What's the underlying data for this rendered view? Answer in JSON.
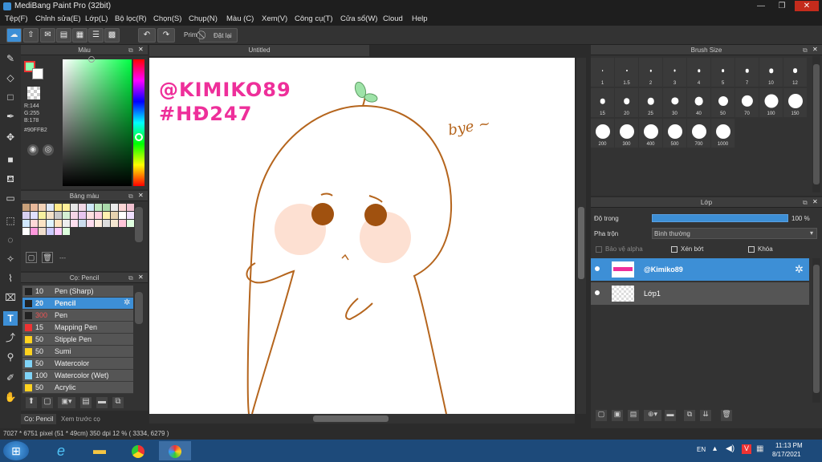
{
  "window": {
    "title": "MediBang Paint Pro (32bit)"
  },
  "menu": [
    "Tệp(F)",
    "Chỉnh sửa(E)",
    "Lớp(L)",
    "Bộ lọc(R)",
    "Chọn(S)",
    "Chụp(N)",
    "Màu (C)",
    "Xem(V)",
    "Công cụ(T)",
    "Cửa sổ(W)",
    "Cloud",
    "Help"
  ],
  "toolbar": {
    "prim_label": "Prim",
    "reset_label": "Đặt lại"
  },
  "color_panel": {
    "title": "Màu",
    "r": "R:144",
    "g": "G:255",
    "b": "B:178",
    "hex": "#90FFB2"
  },
  "palette_panel": {
    "title": "Bảng màu",
    "dash": "---"
  },
  "brush_panel": {
    "title": "Cọ: Pencil",
    "items": [
      {
        "size": "10",
        "name": "Pen (Sharp)",
        "color": "#222"
      },
      {
        "size": "20",
        "name": "Pencil",
        "color": "#222"
      },
      {
        "size": "300",
        "name": "Pen",
        "color": "#222"
      },
      {
        "size": "15",
        "name": "Mapping Pen",
        "color": "#e33"
      },
      {
        "size": "50",
        "name": "Stipple Pen",
        "color": "#ffd21f"
      },
      {
        "size": "50",
        "name": "Sumi",
        "color": "#ffd21f"
      },
      {
        "size": "50",
        "name": "Watercolor",
        "color": "#7fd3f7"
      },
      {
        "size": "100",
        "name": "Watercolor (Wet)",
        "color": "#7fd3f7"
      },
      {
        "size": "50",
        "name": "Acrylic",
        "color": "#ffd21f"
      }
    ]
  },
  "bottom_tabs": {
    "tab1": "Cọ: Pencil",
    "tab2": "Xem trước cọ"
  },
  "canvas": {
    "tab_title": "Untitled",
    "watermark1": "@KIMIKO89",
    "watermark2": "#HĐ247",
    "doodle_text": "bye ~"
  },
  "brush_size": {
    "title": "Brush Size",
    "sizes": [
      "1",
      "1.5",
      "2",
      "3",
      "4",
      "5",
      "7",
      "10",
      "12",
      "15",
      "20",
      "25",
      "30",
      "40",
      "50",
      "70",
      "100",
      "150",
      "200",
      "300",
      "400",
      "500",
      "700",
      "1000"
    ]
  },
  "layer_panel": {
    "title": "Lớp",
    "opacity_label": "Độ trong",
    "opacity_value": "100 %",
    "blend_label": "Pha trộn",
    "blend_value": "Bình thường",
    "protect_alpha": "Bảo vệ alpha",
    "clip": "Xén bớt",
    "lock": "Khóa",
    "layers": [
      {
        "name": "@Kimiko89"
      },
      {
        "name": "Lớp1"
      }
    ]
  },
  "status": {
    "text": "7027 * 6751 pixel   (51 * 49cm)   350 dpi   12 %   ( 3334, 6279 )"
  },
  "taskbar": {
    "lang": "EN",
    "time": "11:13 PM",
    "date": "8/17/2021"
  },
  "colors": {
    "accent": "#3d8fd6",
    "watermark": "#ee2f9a",
    "line": "#b5651d"
  }
}
